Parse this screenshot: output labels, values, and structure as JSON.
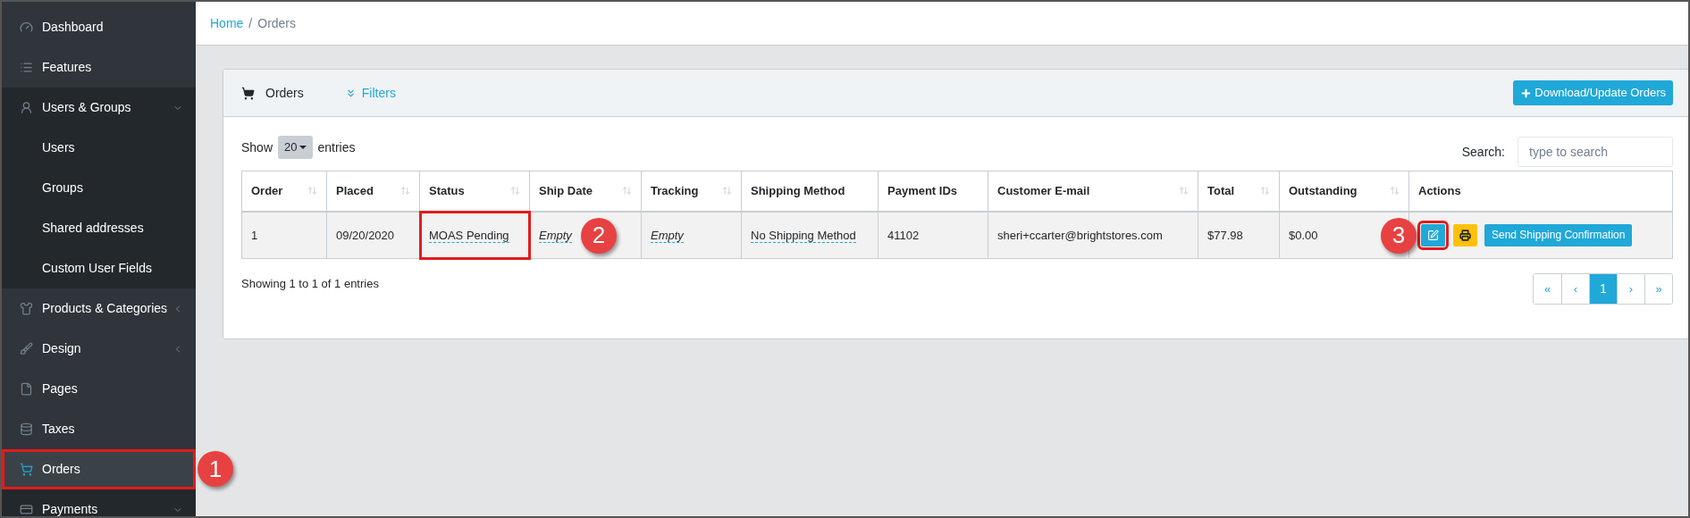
{
  "sidebar": {
    "items": [
      {
        "label": "Dashboard",
        "selected": false,
        "highlighted": false,
        "has_submenu": false
      },
      {
        "label": "Features",
        "selected": false,
        "highlighted": false,
        "has_submenu": false
      },
      {
        "label": "Users & Groups",
        "selected": false,
        "highlighted": false,
        "has_submenu": true,
        "expanded": true,
        "children": [
          {
            "label": "Users"
          },
          {
            "label": "Groups"
          },
          {
            "label": "Shared addresses"
          },
          {
            "label": "Custom User Fields"
          }
        ]
      },
      {
        "label": "Products & Categories",
        "selected": false,
        "highlighted": false,
        "has_submenu": true,
        "expanded": false
      },
      {
        "label": "Design",
        "selected": false,
        "highlighted": false,
        "has_submenu": true,
        "expanded": false
      },
      {
        "label": "Pages",
        "selected": false,
        "highlighted": false,
        "has_submenu": false
      },
      {
        "label": "Taxes",
        "selected": false,
        "highlighted": false,
        "has_submenu": false
      },
      {
        "label": "Orders",
        "selected": true,
        "highlighted": true,
        "has_submenu": false,
        "callout": "1"
      },
      {
        "label": "Payments",
        "selected": false,
        "highlighted": false,
        "has_submenu": true,
        "expanded": true
      }
    ]
  },
  "breadcrumb": {
    "separator": "/",
    "items": [
      {
        "label": "Home",
        "link": true
      },
      {
        "label": "Orders",
        "link": false
      }
    ]
  },
  "card": {
    "title": "Orders",
    "filters": "Filters",
    "download_button": "Download/Update Orders"
  },
  "table_controls": {
    "show": "Show",
    "page_size": "20",
    "entries": "entries",
    "search_label": "Search:",
    "search_placeholder": "type to search"
  },
  "table": {
    "columns": [
      {
        "label": "Order",
        "sortable": true
      },
      {
        "label": "Placed",
        "sortable": true
      },
      {
        "label": "Status",
        "sortable": true
      },
      {
        "label": "Ship Date",
        "sortable": true
      },
      {
        "label": "Tracking",
        "sortable": true
      },
      {
        "label": "Shipping Method",
        "sortable": false
      },
      {
        "label": "Payment IDs",
        "sortable": false
      },
      {
        "label": "Customer E-mail",
        "sortable": true
      },
      {
        "label": "Total",
        "sortable": true
      },
      {
        "label": "Outstanding",
        "sortable": true
      },
      {
        "label": "Actions",
        "sortable": false
      }
    ],
    "rows": [
      {
        "cells": [
          {
            "text": "1",
            "kind": "plain"
          },
          {
            "text": "09/20/2020",
            "kind": "plain"
          },
          {
            "text": "MOAS Pending",
            "kind": "editable",
            "highlighted": true,
            "callout": "2"
          },
          {
            "text": "Empty",
            "kind": "empty"
          },
          {
            "text": "Empty",
            "kind": "empty"
          },
          {
            "text": "No Shipping Method",
            "kind": "editable"
          },
          {
            "text": "41102",
            "kind": "plain"
          },
          {
            "text": "sheri+ccarter@brightstores.com",
            "kind": "plain"
          },
          {
            "text": "$77.98",
            "kind": "plain"
          },
          {
            "text": "$0.00",
            "kind": "plain"
          }
        ],
        "actions": {
          "callout": "3",
          "edit_highlighted": true,
          "send_button": "Send Shipping Confirmation"
        }
      }
    ]
  },
  "footer": {
    "info": "Showing 1 to 1 of 1 entries",
    "pages": [
      {
        "label": "«",
        "selected": false
      },
      {
        "label": "‹",
        "selected": false
      },
      {
        "label": "1",
        "selected": true
      },
      {
        "label": "›",
        "selected": false
      },
      {
        "label": "»",
        "selected": false
      }
    ]
  }
}
